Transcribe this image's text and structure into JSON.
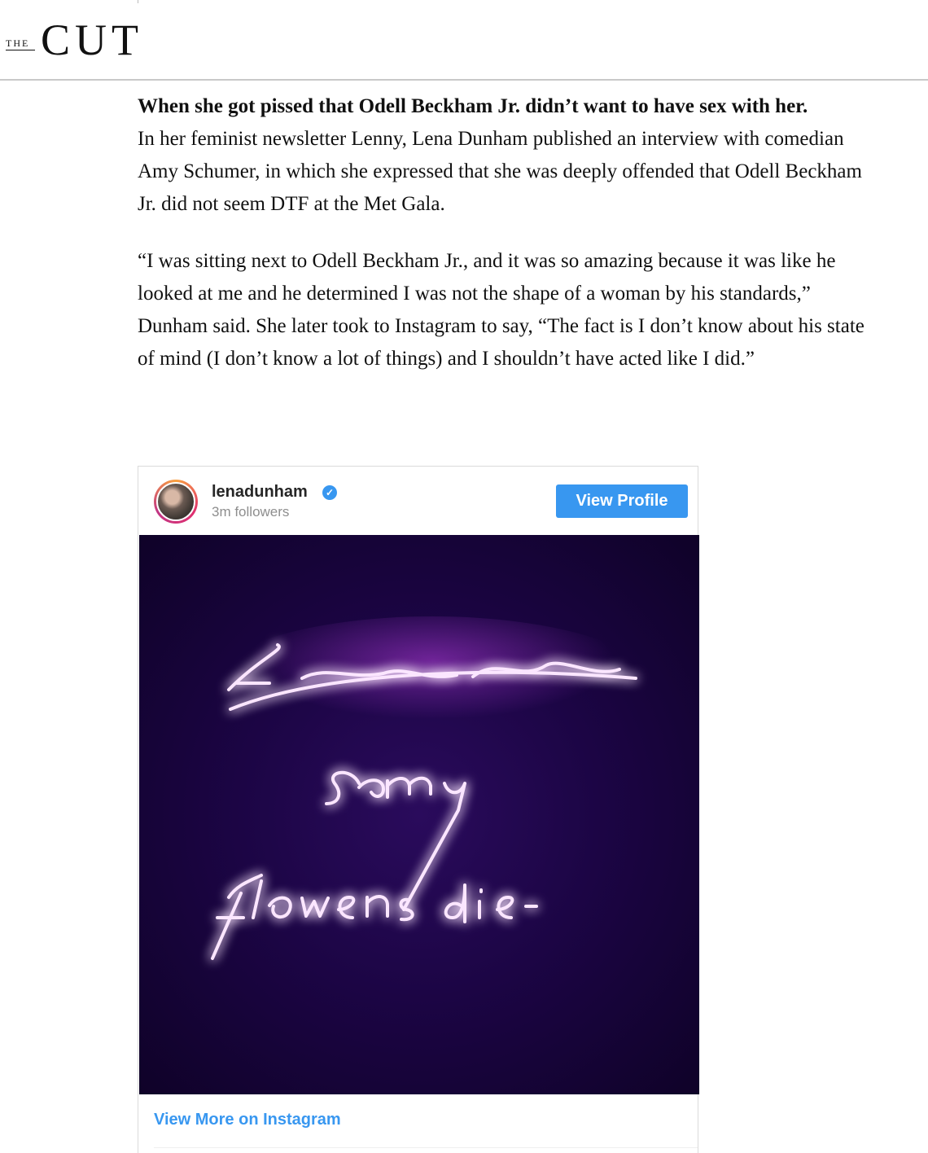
{
  "header": {
    "logo_small": "THE",
    "logo_big": "CUT"
  },
  "article": {
    "heading": "When she got pissed that Odell Beckham Jr. didn’t want to have sex with her.",
    "paragraph_1": "In her feminist newsletter Lenny, Lena Dunham published an interview with comedian Amy Schumer, in which she expressed that she was deeply offended that Odell Beckham Jr. did not seem DTF at the Met Gala.",
    "paragraph_2": "“I was sitting next to Odell Beckham Jr., and it was so amazing because it was like he looked at me and he determined I was not the shape of a woman by his standards,” Dunham said. She later took to Instagram to say, “The fact is I don’t know about his state of mind (I don’t know a lot of things) and I shouldn’t have acted like I did.”"
  },
  "instagram": {
    "username": "lenadunham",
    "verified_icon": "verified-badge-icon",
    "followers": "3m followers",
    "view_profile_label": "View Profile",
    "view_more_label": "View More on Instagram",
    "accent_color": "#3897f0"
  }
}
